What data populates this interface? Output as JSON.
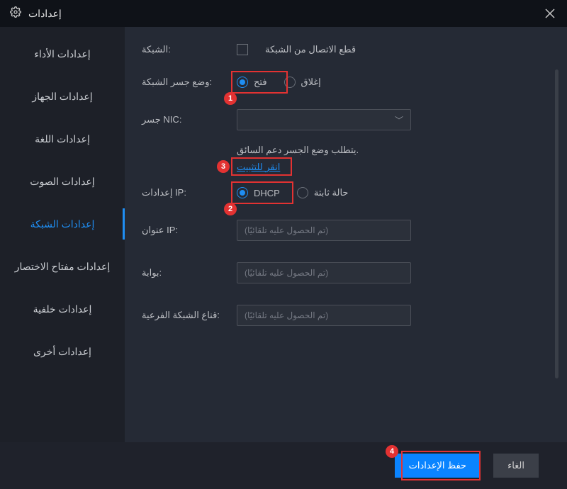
{
  "titlebar": {
    "title": "إعدادات"
  },
  "sidebar": {
    "items": [
      {
        "label": "إعدادات الأداء"
      },
      {
        "label": "إعدادات الجهاز"
      },
      {
        "label": "إعدادات اللغة"
      },
      {
        "label": "إعدادات الصوت"
      },
      {
        "label": "إعدادات الشبكة"
      },
      {
        "label": "إعدادات مفتاح الاختصار"
      },
      {
        "label": "إعدادات خلفية"
      },
      {
        "label": "إعدادات أخرى"
      }
    ],
    "active_index": 4
  },
  "network": {
    "disconnect_label": "الشبكة:",
    "disconnect_checkbox": "قطع الاتصال من الشبكة",
    "bridge_label": "وضع جسر الشبكة:",
    "bridge_open": "فتح",
    "bridge_close": "إغلاق",
    "nic_label": "جسر NIC:",
    "driver_note": "يتطلب وضع الجسر دعم السائق.",
    "install_link": "انقر للتثبيت",
    "ip_settings_label": "إعدادات IP:",
    "ip_dhcp": "DHCP",
    "ip_static": "حالة ثابتة",
    "ip_addr_label": "عنوان IP:",
    "gateway_label": "بوابة:",
    "subnet_label": "قناع الشبكة الفرعية:",
    "auto_placeholder": "(تم الحصول عليه تلقائيًا)"
  },
  "footer": {
    "save": "حفظ الإعدادات",
    "cancel": "الغاء"
  },
  "annotations": {
    "b1": "1",
    "b2": "2",
    "b3": "3",
    "b4": "4"
  }
}
